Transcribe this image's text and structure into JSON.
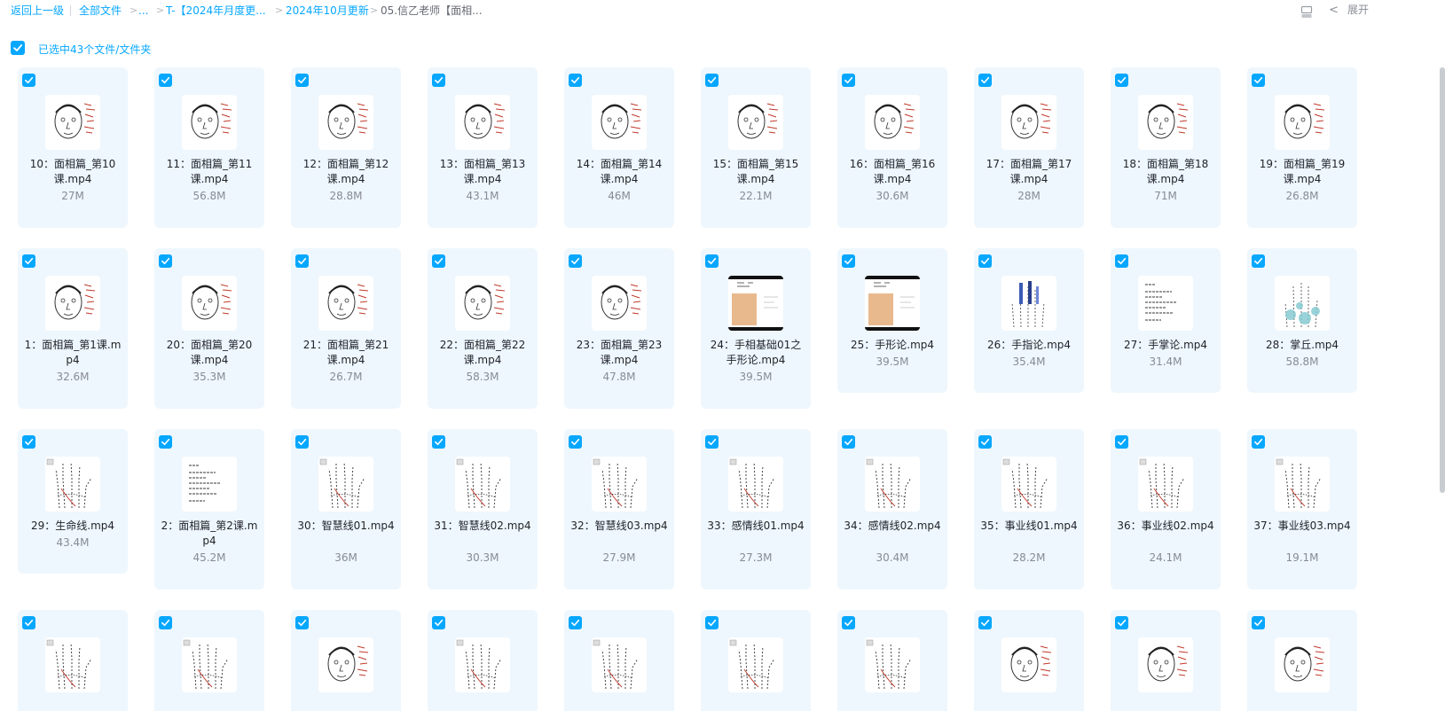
{
  "breadcrumb": {
    "back": "返回上一级",
    "all_files": "全部文件",
    "sep": ">",
    "ellipsis": "...",
    "folder1": "T-【2024年月度更...",
    "folder2": "2024年10月更新",
    "current": "05.信乙老师【面相..."
  },
  "toolbar": {
    "expand_label": "展开",
    "chevron": "<"
  },
  "selection": {
    "text": "已选中43个文件/文件夹"
  },
  "colors": {
    "accent": "#06a7ff",
    "card_bg": "#eef7fd"
  },
  "rows": [
    [
      {
        "name": "10：面相篇_第10课.mp4",
        "size": "27M",
        "kind": "face"
      },
      {
        "name": "11：面相篇_第11课.mp4",
        "size": "56.8M",
        "kind": "face"
      },
      {
        "name": "12：面相篇_第12课.mp4",
        "size": "28.8M",
        "kind": "face"
      },
      {
        "name": "13：面相篇_第13课.mp4",
        "size": "43.1M",
        "kind": "face"
      },
      {
        "name": "14：面相篇_第14课.mp4",
        "size": "46M",
        "kind": "face"
      },
      {
        "name": "15：面相篇_第15课.mp4",
        "size": "22.1M",
        "kind": "face"
      },
      {
        "name": "16：面相篇_第16课.mp4",
        "size": "30.6M",
        "kind": "face"
      },
      {
        "name": "17：面相篇_第17课.mp4",
        "size": "28M",
        "kind": "face"
      },
      {
        "name": "18：面相篇_第18课.mp4",
        "size": "71M",
        "kind": "face"
      },
      {
        "name": "19：面相篇_第19课.mp4",
        "size": "26.8M",
        "kind": "face"
      }
    ],
    [
      {
        "name": "1：面相篇_第1课.mp4",
        "size": "32.6M",
        "kind": "face"
      },
      {
        "name": "20：面相篇_第20课.mp4",
        "size": "35.3M",
        "kind": "face"
      },
      {
        "name": "21：面相篇_第21课.mp4",
        "size": "26.7M",
        "kind": "face"
      },
      {
        "name": "22：面相篇_第22课.mp4",
        "size": "58.3M",
        "kind": "face"
      },
      {
        "name": "23：面相篇_第23课.mp4",
        "size": "47.8M",
        "kind": "face"
      },
      {
        "name": "24：手相基础01之手形论.mp4",
        "size": "39.5M",
        "kind": "palm-photo"
      },
      {
        "name": "25：手形论.mp4",
        "size": "39.5M",
        "kind": "palm-photo"
      },
      {
        "name": "26：手指论.mp4",
        "size": "35.4M",
        "kind": "hand-blue"
      },
      {
        "name": "27：手掌论.mp4",
        "size": "31.4M",
        "kind": "text"
      },
      {
        "name": "28：掌丘.mp4",
        "size": "58.8M",
        "kind": "hand-teal"
      }
    ],
    [
      {
        "name": "29：生命线.mp4",
        "size": "43.4M",
        "kind": "hand"
      },
      {
        "name": "2：面相篇_第2课.mp4",
        "size": "45.2M",
        "kind": "text"
      },
      {
        "name": "30：智慧线01.mp4",
        "size": "36M",
        "kind": "hand"
      },
      {
        "name": "31：智慧线02.mp4",
        "size": "30.3M",
        "kind": "hand"
      },
      {
        "name": "32：智慧线03.mp4",
        "size": "27.9M",
        "kind": "hand"
      },
      {
        "name": "33：感情线01.mp4",
        "size": "27.3M",
        "kind": "hand"
      },
      {
        "name": "34：感情线02.mp4",
        "size": "30.4M",
        "kind": "hand"
      },
      {
        "name": "35：事业线01.mp4",
        "size": "28.2M",
        "kind": "hand"
      },
      {
        "name": "36：事业线02.mp4",
        "size": "24.1M",
        "kind": "hand"
      },
      {
        "name": "37：事业线03.mp4",
        "size": "19.1M",
        "kind": "hand"
      }
    ],
    [
      {
        "name": "",
        "size": "",
        "kind": "hand"
      },
      {
        "name": "",
        "size": "",
        "kind": "hand"
      },
      {
        "name": "",
        "size": "",
        "kind": "face"
      },
      {
        "name": "",
        "size": "",
        "kind": "hand"
      },
      {
        "name": "",
        "size": "",
        "kind": "hand"
      },
      {
        "name": "",
        "size": "",
        "kind": "hand"
      },
      {
        "name": "",
        "size": "",
        "kind": "hand"
      },
      {
        "name": "",
        "size": "",
        "kind": "face"
      },
      {
        "name": "",
        "size": "",
        "kind": "face"
      },
      {
        "name": "",
        "size": "",
        "kind": "face"
      }
    ]
  ]
}
